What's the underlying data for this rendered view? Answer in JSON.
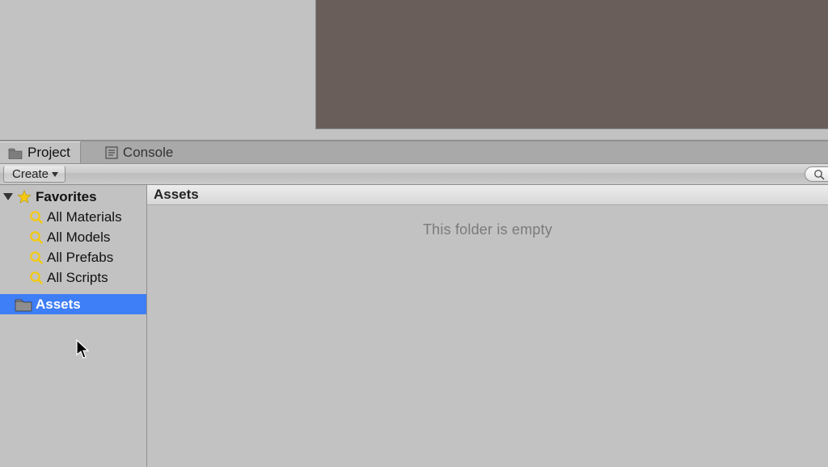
{
  "tabs": {
    "project": "Project",
    "console": "Console"
  },
  "toolbar": {
    "create_label": "Create"
  },
  "colors": {
    "selection": "#3e7ef6",
    "accent_yellow": "#f4c90d"
  },
  "sidebar": {
    "favorites_label": "Favorites",
    "favorites": [
      {
        "label": "All Materials"
      },
      {
        "label": "All Models"
      },
      {
        "label": "All Prefabs"
      },
      {
        "label": "All Scripts"
      }
    ],
    "assets_label": "Assets"
  },
  "content": {
    "breadcrumb": "Assets",
    "empty_message": "This folder is empty"
  }
}
